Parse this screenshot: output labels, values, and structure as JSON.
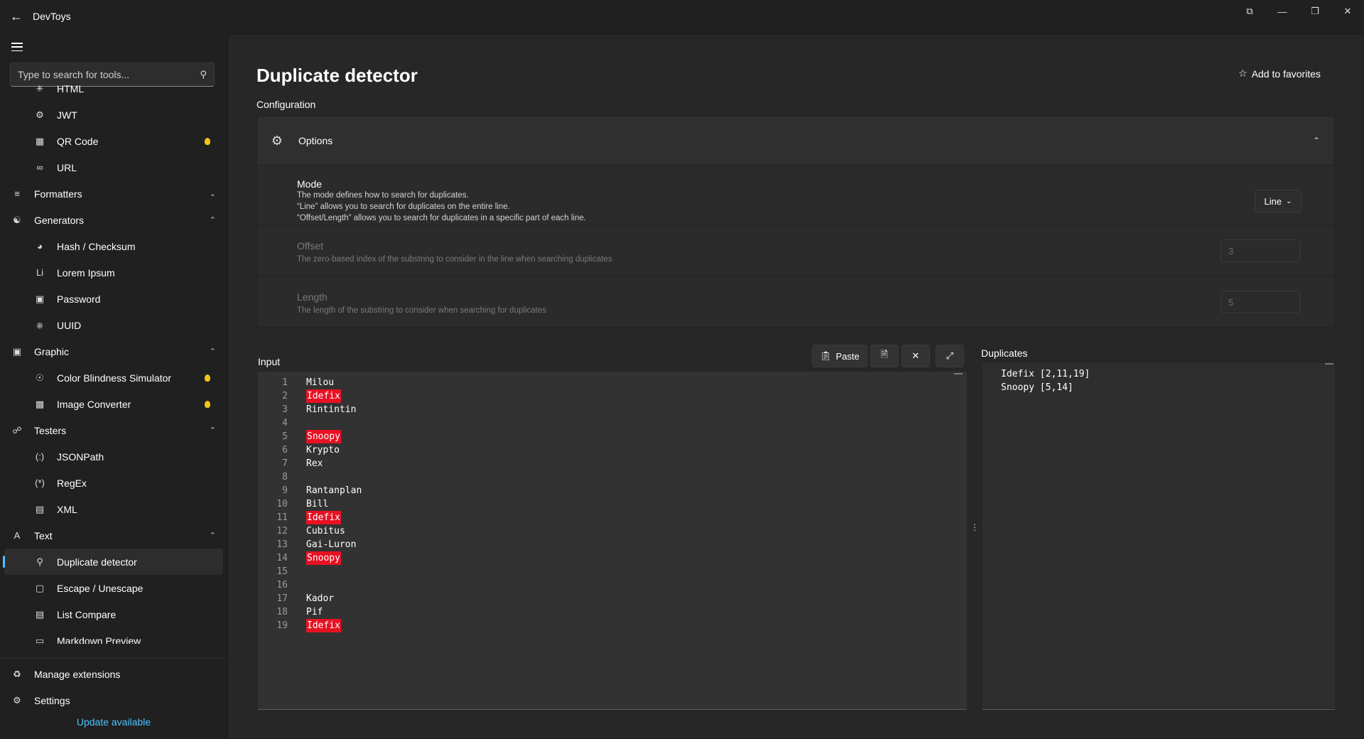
{
  "app": {
    "title": "DevToys"
  },
  "search": {
    "placeholder": "Type to search for tools..."
  },
  "sidebar": {
    "items": [
      {
        "label": "HTML",
        "icon": "html-icon",
        "kind": "child"
      },
      {
        "label": "JWT",
        "icon": "gear-icon",
        "kind": "child"
      },
      {
        "label": "QR Code",
        "icon": "qr-icon",
        "kind": "child",
        "new": true
      },
      {
        "label": "URL",
        "icon": "link-icon",
        "kind": "child"
      },
      {
        "label": "Formatters",
        "icon": "formatters-icon",
        "kind": "group",
        "chevron": "down"
      },
      {
        "label": "Generators",
        "icon": "generators-icon",
        "kind": "group",
        "chevron": "up"
      },
      {
        "label": "Hash / Checksum",
        "icon": "fingerprint-icon",
        "kind": "child"
      },
      {
        "label": "Lorem Ipsum",
        "icon": "lorem-icon",
        "kind": "child"
      },
      {
        "label": "Password",
        "icon": "password-icon",
        "kind": "child"
      },
      {
        "label": "UUID",
        "icon": "uuid-icon",
        "kind": "child"
      },
      {
        "label": "Graphic",
        "icon": "image-icon",
        "kind": "group",
        "chevron": "up"
      },
      {
        "label": "Color Blindness Simulator",
        "icon": "eye-icon",
        "kind": "child",
        "new": true
      },
      {
        "label": "Image Converter",
        "icon": "image-convert-icon",
        "kind": "child",
        "new": true
      },
      {
        "label": "Testers",
        "icon": "testers-icon",
        "kind": "group",
        "chevron": "up"
      },
      {
        "label": "JSONPath",
        "icon": "jsonpath-icon",
        "kind": "child"
      },
      {
        "label": "RegEx",
        "icon": "regex-icon",
        "kind": "child"
      },
      {
        "label": "XML",
        "icon": "xml-icon",
        "kind": "child"
      },
      {
        "label": "Text",
        "icon": "text-icon",
        "kind": "group",
        "chevron": "up"
      },
      {
        "label": "Duplicate detector",
        "icon": "search-icon",
        "kind": "child",
        "selected": true
      },
      {
        "label": "Escape / Unescape",
        "icon": "escape-icon",
        "kind": "child"
      },
      {
        "label": "List Compare",
        "icon": "list-compare-icon",
        "kind": "child"
      },
      {
        "label": "Markdown Preview",
        "icon": "markdown-icon",
        "kind": "child"
      }
    ],
    "bottom": [
      {
        "label": "Manage extensions",
        "icon": "extensions-icon"
      },
      {
        "label": "Settings",
        "icon": "gear-icon"
      }
    ],
    "update": "Update available"
  },
  "page": {
    "title": "Duplicate detector",
    "favorite": "Add to favorites",
    "configuration": "Configuration",
    "options": "Options",
    "mode": {
      "title": "Mode",
      "desc1": "The mode defines how to search for duplicates.",
      "desc2": "“Line” allows you to search for duplicates on the entire line.",
      "desc3": "“Offset/Length” allows you to search for duplicates in a specific part of each line.",
      "value": "Line"
    },
    "offset": {
      "title": "Offset",
      "desc": "The zero-based index of the substring to consider in the line when searching duplicates",
      "value": "3"
    },
    "length": {
      "title": "Length",
      "desc": "The length of the substring to consider when searching for duplicates",
      "value": "5"
    },
    "input_label": "Input",
    "paste": "Paste",
    "duplicates_label": "Duplicates"
  },
  "input_lines": [
    {
      "n": "1",
      "text": "Milou",
      "dup": false
    },
    {
      "n": "2",
      "text": "Idefix",
      "dup": true
    },
    {
      "n": "3",
      "text": "Rintintin",
      "dup": false
    },
    {
      "n": "4",
      "text": "",
      "dup": false
    },
    {
      "n": "5",
      "text": "Snoopy",
      "dup": true
    },
    {
      "n": "6",
      "text": "Krypto",
      "dup": false
    },
    {
      "n": "7",
      "text": "Rex",
      "dup": false
    },
    {
      "n": "8",
      "text": "",
      "dup": false
    },
    {
      "n": "9",
      "text": "Rantanplan",
      "dup": false
    },
    {
      "n": "10",
      "text": "Bill",
      "dup": false
    },
    {
      "n": "11",
      "text": "Idefix",
      "dup": true
    },
    {
      "n": "12",
      "text": "Cubitus",
      "dup": false
    },
    {
      "n": "13",
      "text": "Gai-Luron",
      "dup": false
    },
    {
      "n": "14",
      "text": "Snoopy",
      "dup": true
    },
    {
      "n": "15",
      "text": "",
      "dup": false
    },
    {
      "n": "16",
      "text": "",
      "dup": false
    },
    {
      "n": "17",
      "text": "Kador",
      "dup": false
    },
    {
      "n": "18",
      "text": "Pif",
      "dup": false
    },
    {
      "n": "19",
      "text": "Idefix",
      "dup": true
    }
  ],
  "duplicates": [
    "Idefix [2,11,19]",
    "Snoopy [5,14]"
  ],
  "colors": {
    "accent": "#4cc2ff",
    "duplicate_highlight": "#e81123",
    "new_badge": "#f0c419"
  }
}
